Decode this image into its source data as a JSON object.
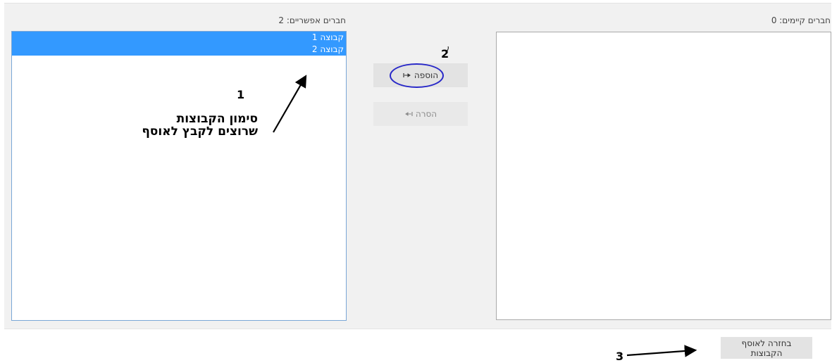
{
  "potential": {
    "heading": "חברים אפשריים: 2",
    "options": [
      "קבוצה 1",
      "קבוצה 2"
    ]
  },
  "existing": {
    "heading": "חברים קיימים: 0"
  },
  "buttons": {
    "add_label": "הוספה",
    "remove_label": "הסרה",
    "back_label": "בחזרה לאוסף הקבוצות"
  },
  "annotations": {
    "step1": "1",
    "step1_text": "סימון הקבוצות שרוצים לקבץ לאוסף",
    "step2": "2",
    "step3": "3"
  },
  "icons": {
    "add": "arrow-right-icon",
    "remove": "arrow-left-icon"
  },
  "colors": {
    "selection": "#3399ff",
    "circle": "#2828c8",
    "panel": "#f1f1f1"
  }
}
